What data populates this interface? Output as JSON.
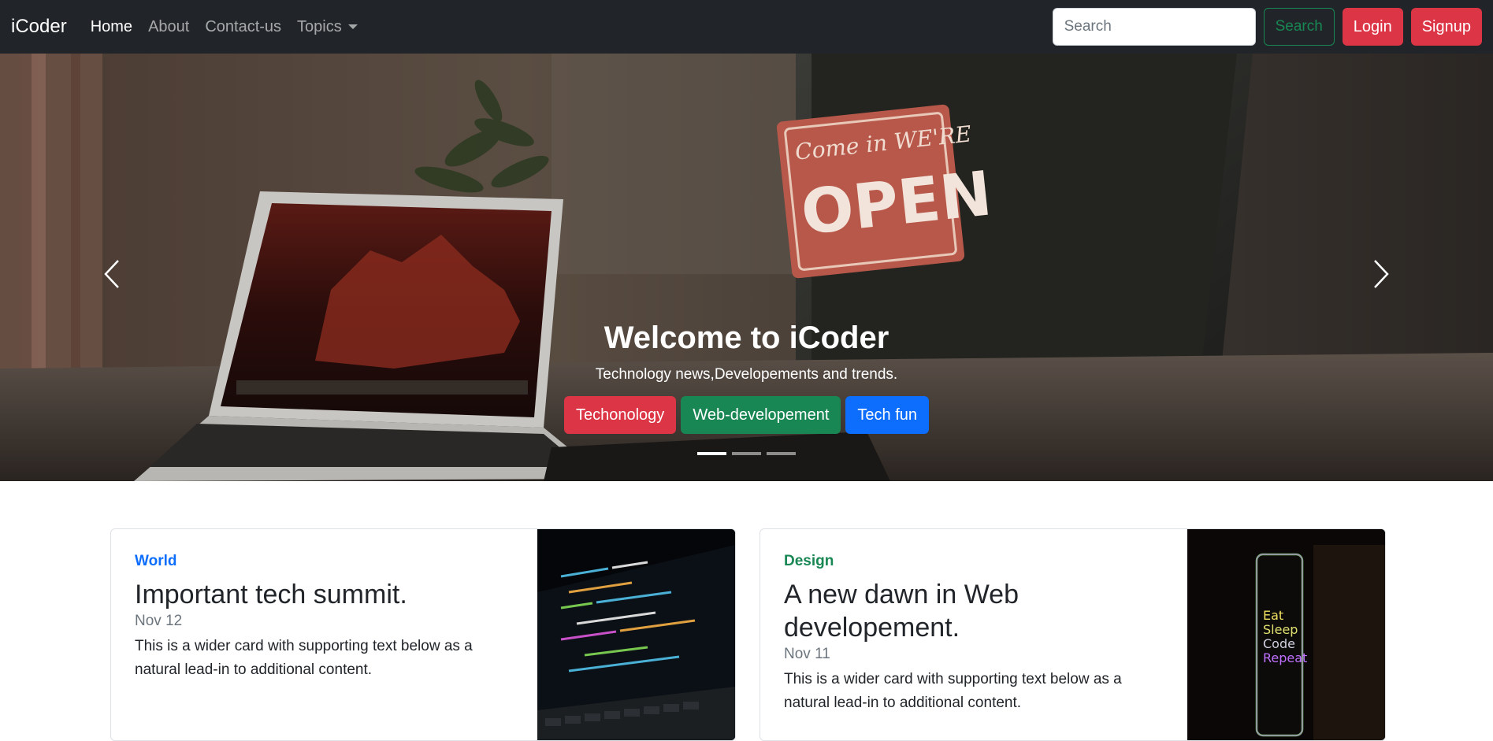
{
  "navbar": {
    "brand": "iCoder",
    "links": [
      {
        "label": "Home",
        "active": true
      },
      {
        "label": "About",
        "active": false
      },
      {
        "label": "Contact-us",
        "active": false
      },
      {
        "label": "Topics",
        "active": false
      }
    ],
    "search_placeholder": "Search",
    "search_button": "Search",
    "login_button": "Login",
    "signup_button": "Signup"
  },
  "carousel": {
    "title": "Welcome to iCoder",
    "subtitle": "Technology news,Developements and trends.",
    "buttons": [
      "Techonology",
      "Web-developement",
      "Tech fun"
    ],
    "sign_text_top": "Come in WE'RE",
    "sign_text_main": "OPEN",
    "slide_count": 3,
    "active_slide": 1
  },
  "cards": [
    {
      "category": "World",
      "title": "Important tech summit.",
      "date": "Nov 12",
      "text": "This is a wider card with supporting text below as a natural lead-in to additional content."
    },
    {
      "category": "Design",
      "title": "A new dawn in Web developement.",
      "date": "Nov 11",
      "text": "This is a wider card with supporting text below as a natural lead-in to additional content.",
      "image_text": [
        "Eat",
        "Sleep",
        "Code",
        "Repeat"
      ]
    }
  ],
  "colors": {
    "navbar_bg": "#212529",
    "danger": "#dc3545",
    "success": "#198754",
    "primary": "#0d6efd"
  }
}
